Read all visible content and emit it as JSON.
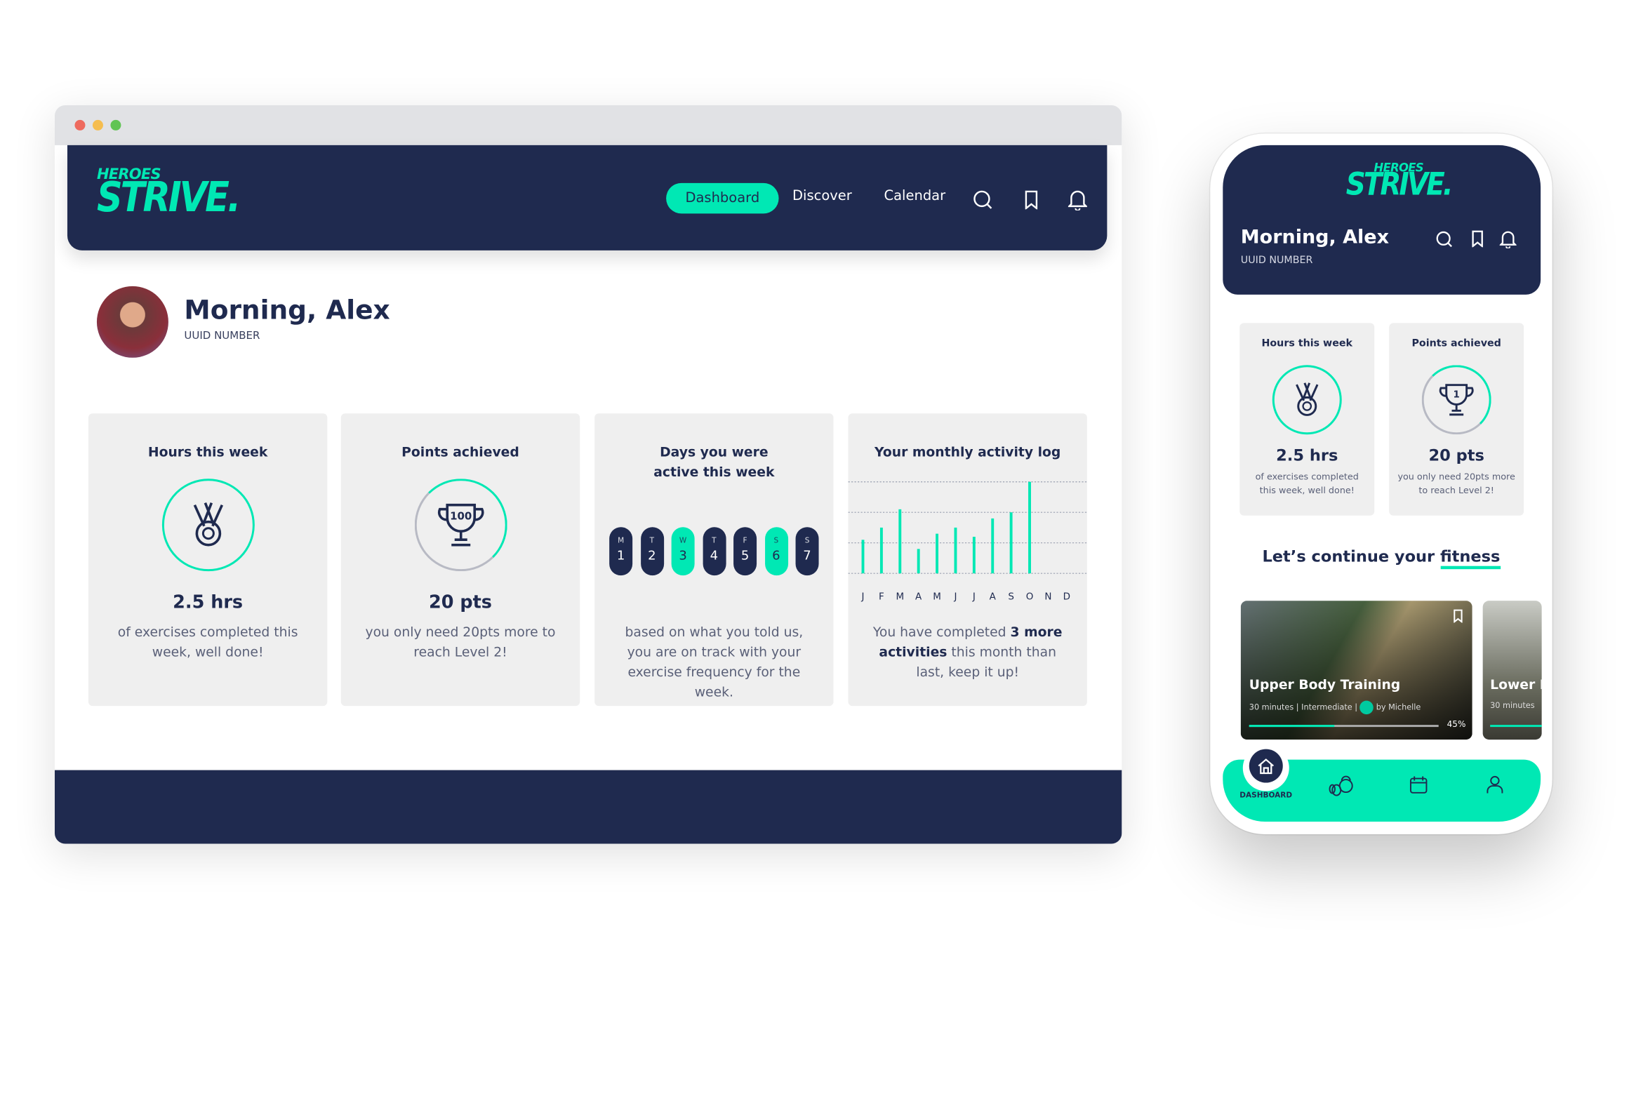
{
  "colors": {
    "navy": "#1f2a4f",
    "accent": "#00e8b4",
    "card": "#efefef"
  },
  "brand": {
    "top": "HEROES",
    "bottom": "STRIVE."
  },
  "desktop": {
    "nav": {
      "items": [
        {
          "label": "Dashboard",
          "active": true
        },
        {
          "label": "Discover"
        },
        {
          "label": "Calendar"
        }
      ],
      "icons": [
        "search-icon",
        "bookmark-icon",
        "bell-icon"
      ]
    },
    "greeting": "Morning, Alex",
    "uuid": "UUID NUMBER",
    "cards": {
      "hours": {
        "title": "Hours this week",
        "value": "2.5 hrs",
        "desc": "of exercises completed this week, well done!",
        "icon": "medal-icon"
      },
      "points": {
        "title": "Points achieved",
        "value": "20 pts",
        "desc": "you only need 20pts more to reach Level 2!",
        "icon": "trophy-icon",
        "badge": "100"
      },
      "days": {
        "title": "Days you were active this week",
        "desc": "based on what you told us, you are on track with your exercise frequency for the week.",
        "days": [
          {
            "l": "M",
            "n": "1",
            "on": false
          },
          {
            "l": "T",
            "n": "2",
            "on": false
          },
          {
            "l": "W",
            "n": "3",
            "on": true
          },
          {
            "l": "T",
            "n": "4",
            "on": false
          },
          {
            "l": "F",
            "n": "5",
            "on": false
          },
          {
            "l": "S",
            "n": "6",
            "on": true
          },
          {
            "l": "S",
            "n": "7",
            "on": false
          }
        ]
      },
      "monthly": {
        "title": "Your monthly activity log",
        "desc_pre": "You have completed ",
        "desc_bold1": "3 more activities",
        "desc_post": " this month than last, keep it up!"
      }
    }
  },
  "chart_data": {
    "type": "bar",
    "categories": [
      "J",
      "F",
      "M",
      "A",
      "M",
      "J",
      "J",
      "A",
      "S",
      "O",
      "N",
      "D"
    ],
    "values": [
      1.1,
      1.5,
      2.1,
      0.8,
      1.3,
      1.5,
      1.2,
      1.8,
      2.0,
      3.0,
      null,
      null
    ],
    "ylim": [
      0,
      3
    ],
    "grid": true,
    "title": "Your monthly activity log"
  },
  "mobile": {
    "greeting": "Morning, Alex",
    "uuid": "UUID NUMBER",
    "cards": [
      {
        "title": "Hours this week",
        "value": "2.5 hrs",
        "desc": "of exercises completed this week, well done!"
      },
      {
        "title": "Points achieved",
        "value": "20 pts",
        "desc": "you only need 20pts more to reach Level 2!",
        "badge": "1"
      }
    ],
    "section_pre": "Let’s continue your ",
    "section_em": "fitness",
    "workouts": [
      {
        "title": "Upper Body Training",
        "duration": "30 minutes",
        "level": "Intermediate",
        "author": "by Michelle",
        "progress": 45,
        "progress_label": "45%"
      },
      {
        "title": "Lower B",
        "duration": "30 minutes"
      }
    ],
    "bottom_nav": {
      "active_label": "DASHBOARD",
      "items": [
        "home-icon",
        "kettlebell-icon",
        "calendar-icon",
        "profile-icon"
      ]
    }
  }
}
